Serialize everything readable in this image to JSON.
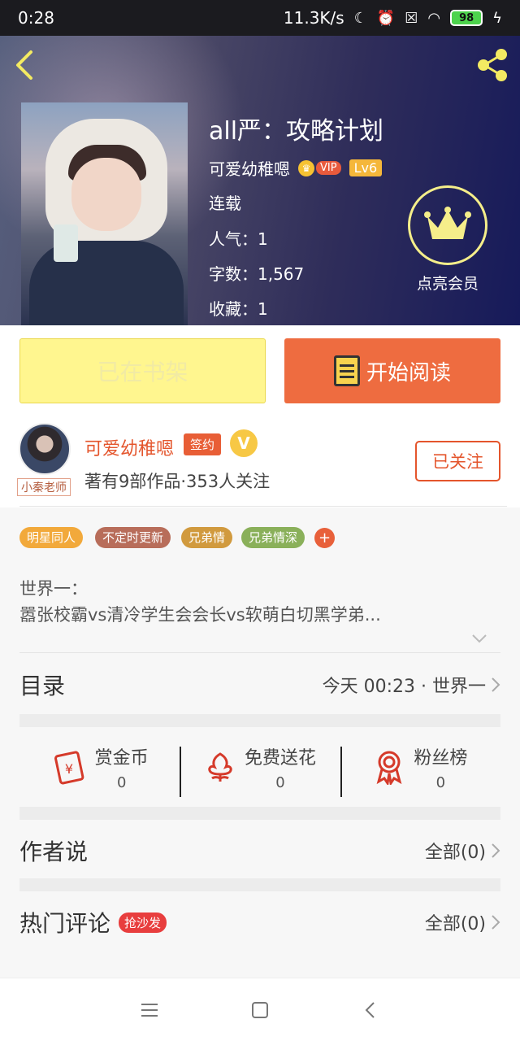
{
  "status_bar": {
    "time": "0:28",
    "net_speed": "11.3K/s",
    "battery": "98"
  },
  "book": {
    "title": "all严：攻略计划",
    "author": "可爱幼稚嗯",
    "vip_label": "VIP",
    "level": "Lv6",
    "status": "连载",
    "popularity": "人气：1",
    "word_count": "字数：1,567",
    "favorites": "收藏：1"
  },
  "member": {
    "label": "点亮会员"
  },
  "actions": {
    "shelf_label": "已在书架",
    "read_label": "开始阅读"
  },
  "author_card": {
    "avatar_tag": "小秦老师",
    "name": "可爱幼稚嗯",
    "sign_badge": "签约",
    "v_badge": "V",
    "stats": "著有9部作品·353人关注",
    "follow_label": "已关注"
  },
  "tags": [
    {
      "label": "明星同人",
      "color": "#f2a93b"
    },
    {
      "label": "不定时更新",
      "color": "#b86d5a"
    },
    {
      "label": "兄弟情",
      "color": "#d19a3e"
    },
    {
      "label": "兄弟情深",
      "color": "#8ab05a"
    }
  ],
  "tag_more": "+",
  "description": {
    "line1": "世界一：",
    "line2": "嚣张校霸vs清冷学生会会长vs软萌白切黑学弟..."
  },
  "catalog": {
    "title": "目录",
    "latest": "今天 00:23 · 世界一"
  },
  "gifts": [
    {
      "label": "赏金币",
      "count": "0",
      "icon": "coin-envelope-icon"
    },
    {
      "label": "免费送花",
      "count": "0",
      "icon": "flower-icon"
    },
    {
      "label": "粉丝榜",
      "count": "0",
      "icon": "medal-icon"
    }
  ],
  "author_says": {
    "title": "作者说",
    "all_label": "全部(0)"
  },
  "hot_comments": {
    "title": "热门评论",
    "badge": "抢沙发",
    "all_label": "全部(0)"
  },
  "colors": {
    "accent": "#ee6c40",
    "author_name": "#e4552c",
    "shelf_bg": "#fff68f"
  }
}
